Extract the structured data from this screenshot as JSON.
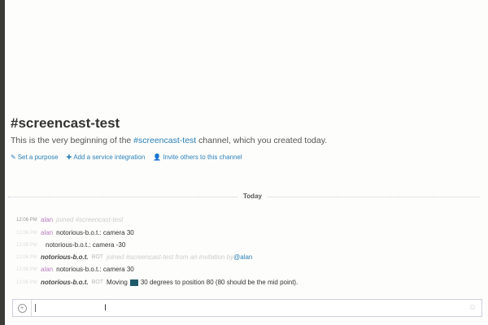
{
  "channel": {
    "title": "#screencast-test",
    "intro_prefix": "This is the very beginning of the ",
    "intro_channel": "#screencast-test",
    "intro_suffix": " channel, which you created today."
  },
  "actions": [
    {
      "icon": "pencil-icon",
      "glyph": "✎",
      "label": "Set a purpose"
    },
    {
      "icon": "plus-icon",
      "glyph": "✚",
      "label": "Add a service integration"
    },
    {
      "icon": "user-icon",
      "glyph": "👤",
      "label": "Invite others to this channel"
    }
  ],
  "divider": "Today",
  "messages": [
    {
      "time": "12:06 PM",
      "user": "alan",
      "text": "joined #screencast-test"
    },
    {
      "time": "12:06 PM",
      "user": "alan",
      "text": "notorious-b.o.t.: camera 30"
    },
    {
      "time": "12:06 PM",
      "user": "",
      "text": "notorious-b.o.t.: camera -30"
    },
    {
      "time": "12:06 PM",
      "user": "notorious-b.o.t.",
      "tag": "BOT",
      "text": "joined #screencast-test from an invitation by ",
      "mention": "@alan"
    },
    {
      "time": "12:06 PM",
      "user": "alan",
      "text": "notorious-b.o.t.: camera 30"
    },
    {
      "time": "12:06 PM",
      "user": "notorious-b.o.t.",
      "tag": "BOT",
      "text_a": "Moving",
      "text_b": "30 degrees to position 80 (80 should be the mid point)."
    }
  ],
  "composer": {
    "plus_icon": "+",
    "emoji_icon": "☺"
  }
}
